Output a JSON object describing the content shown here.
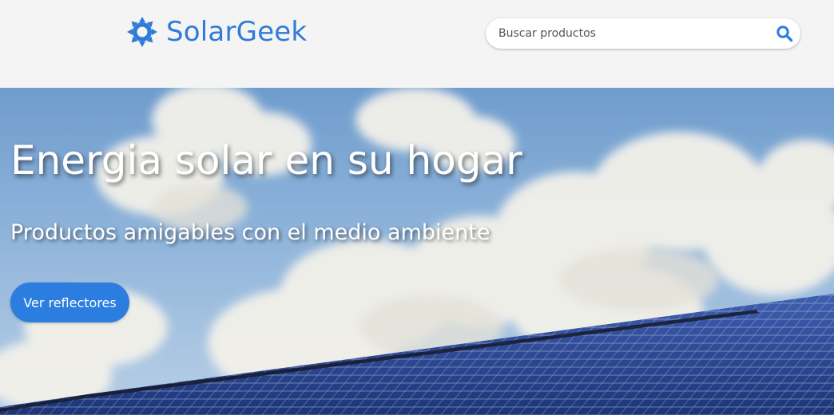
{
  "header": {
    "brand": "SolarGeek",
    "logo_icon": "sun-icon",
    "brand_color": "#2f7bd6"
  },
  "search": {
    "placeholder": "Buscar productos",
    "value": "",
    "button_icon": "search-icon"
  },
  "hero": {
    "title": "Energia solar en su hogar",
    "subtitle": "Productos amigables con el medio ambiente",
    "cta_label": "Ver reflectores",
    "cta_color": "#2b7de0"
  }
}
